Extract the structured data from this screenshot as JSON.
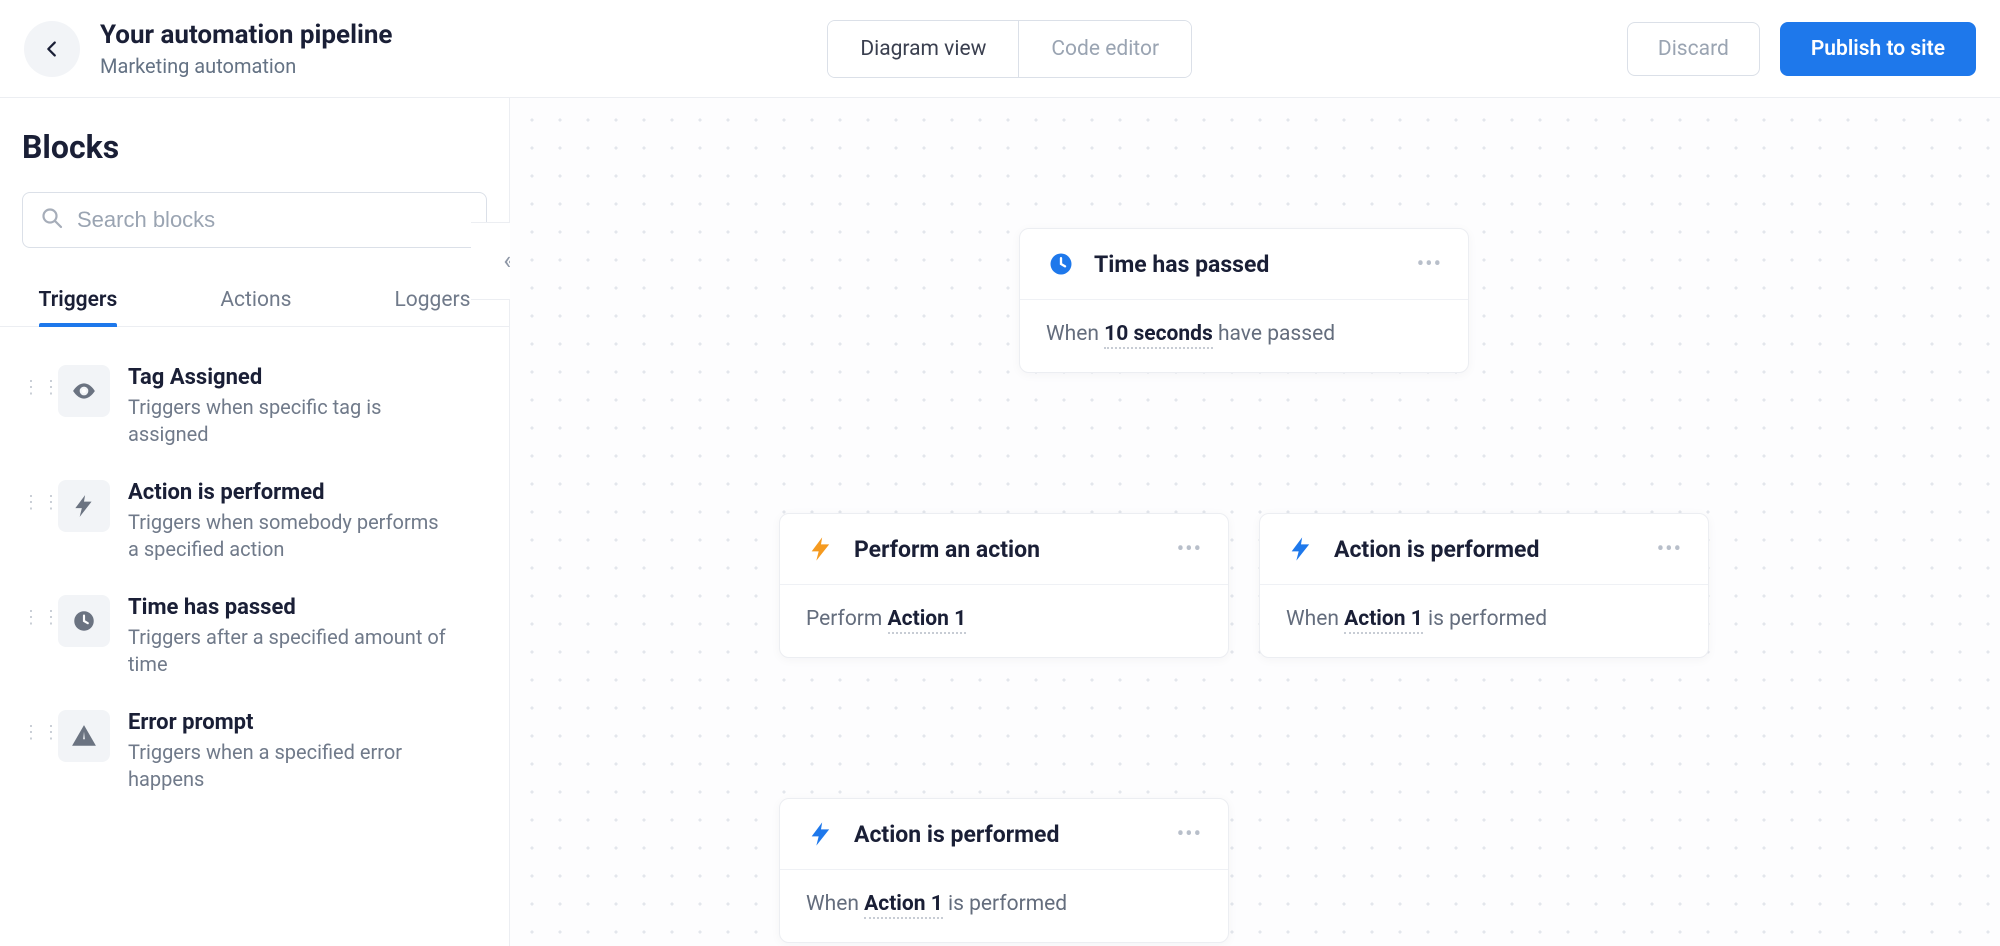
{
  "header": {
    "title": "Your automation pipeline",
    "subtitle": "Marketing automation",
    "view_diagram": "Diagram view",
    "view_code": "Code editor",
    "discard": "Discard",
    "publish": "Publish to site"
  },
  "sidebar": {
    "heading": "Blocks",
    "search_placeholder": "Search blocks",
    "tabs": {
      "triggers": "Triggers",
      "actions": "Actions",
      "loggers": "Loggers"
    },
    "items": [
      {
        "title": "Tag Assigned",
        "desc": "Triggers when specific tag is assigned",
        "icon": "eye"
      },
      {
        "title": "Action is performed",
        "desc": "Triggers when somebody performs a specified action",
        "icon": "bolt"
      },
      {
        "title": "Time has passed",
        "desc": "Triggers after a specified amount of time",
        "icon": "clock"
      },
      {
        "title": "Error prompt",
        "desc": "Triggers when a specified error happens",
        "icon": "warn"
      }
    ]
  },
  "nodes": {
    "n1": {
      "title": "Time has passed",
      "body_pre": "When ",
      "body_param": "10 seconds",
      "body_post": " have passed",
      "color": "#1e78eb",
      "icon": "clock"
    },
    "n2": {
      "title": "Perform an action",
      "body_pre": "Perform ",
      "body_param": "Action 1",
      "body_post": "",
      "color": "#f59a1f",
      "icon": "bolt"
    },
    "n3": {
      "title": "Action is performed",
      "body_pre": "When ",
      "body_param": "Action 1",
      "body_post": " is performed",
      "color": "#1e78eb",
      "icon": "bolt"
    },
    "n4": {
      "title": "Action is performed",
      "body_pre": "When ",
      "body_param": "Action 1",
      "body_post": " is performed",
      "color": "#1e78eb",
      "icon": "bolt"
    }
  }
}
